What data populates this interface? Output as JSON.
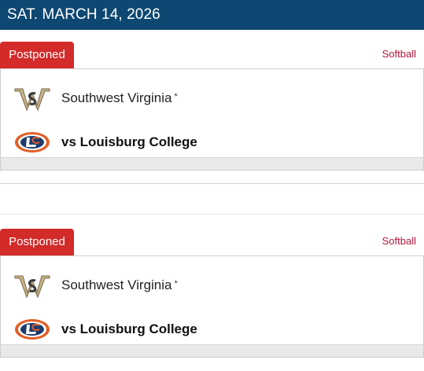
{
  "date_header": "SAT. MARCH 14, 2026",
  "games": [
    {
      "status": "Postponed",
      "sport": "Softball",
      "home_team": {
        "name": "Southwest Virginia",
        "marker": "*",
        "logo": "sw-monogram-icon"
      },
      "away_team": {
        "name": "vs Louisburg College",
        "logo": "louisburg-lc-icon"
      }
    },
    {
      "status": "Postponed",
      "sport": "Softball",
      "home_team": {
        "name": "Southwest Virginia",
        "marker": "*",
        "logo": "sw-monogram-icon"
      },
      "away_team": {
        "name": "vs Louisburg College",
        "logo": "louisburg-lc-icon"
      }
    }
  ],
  "colors": {
    "header_bg": "#0e4872",
    "status_bg": "#d32a2a",
    "sport_link": "#b5163a"
  }
}
